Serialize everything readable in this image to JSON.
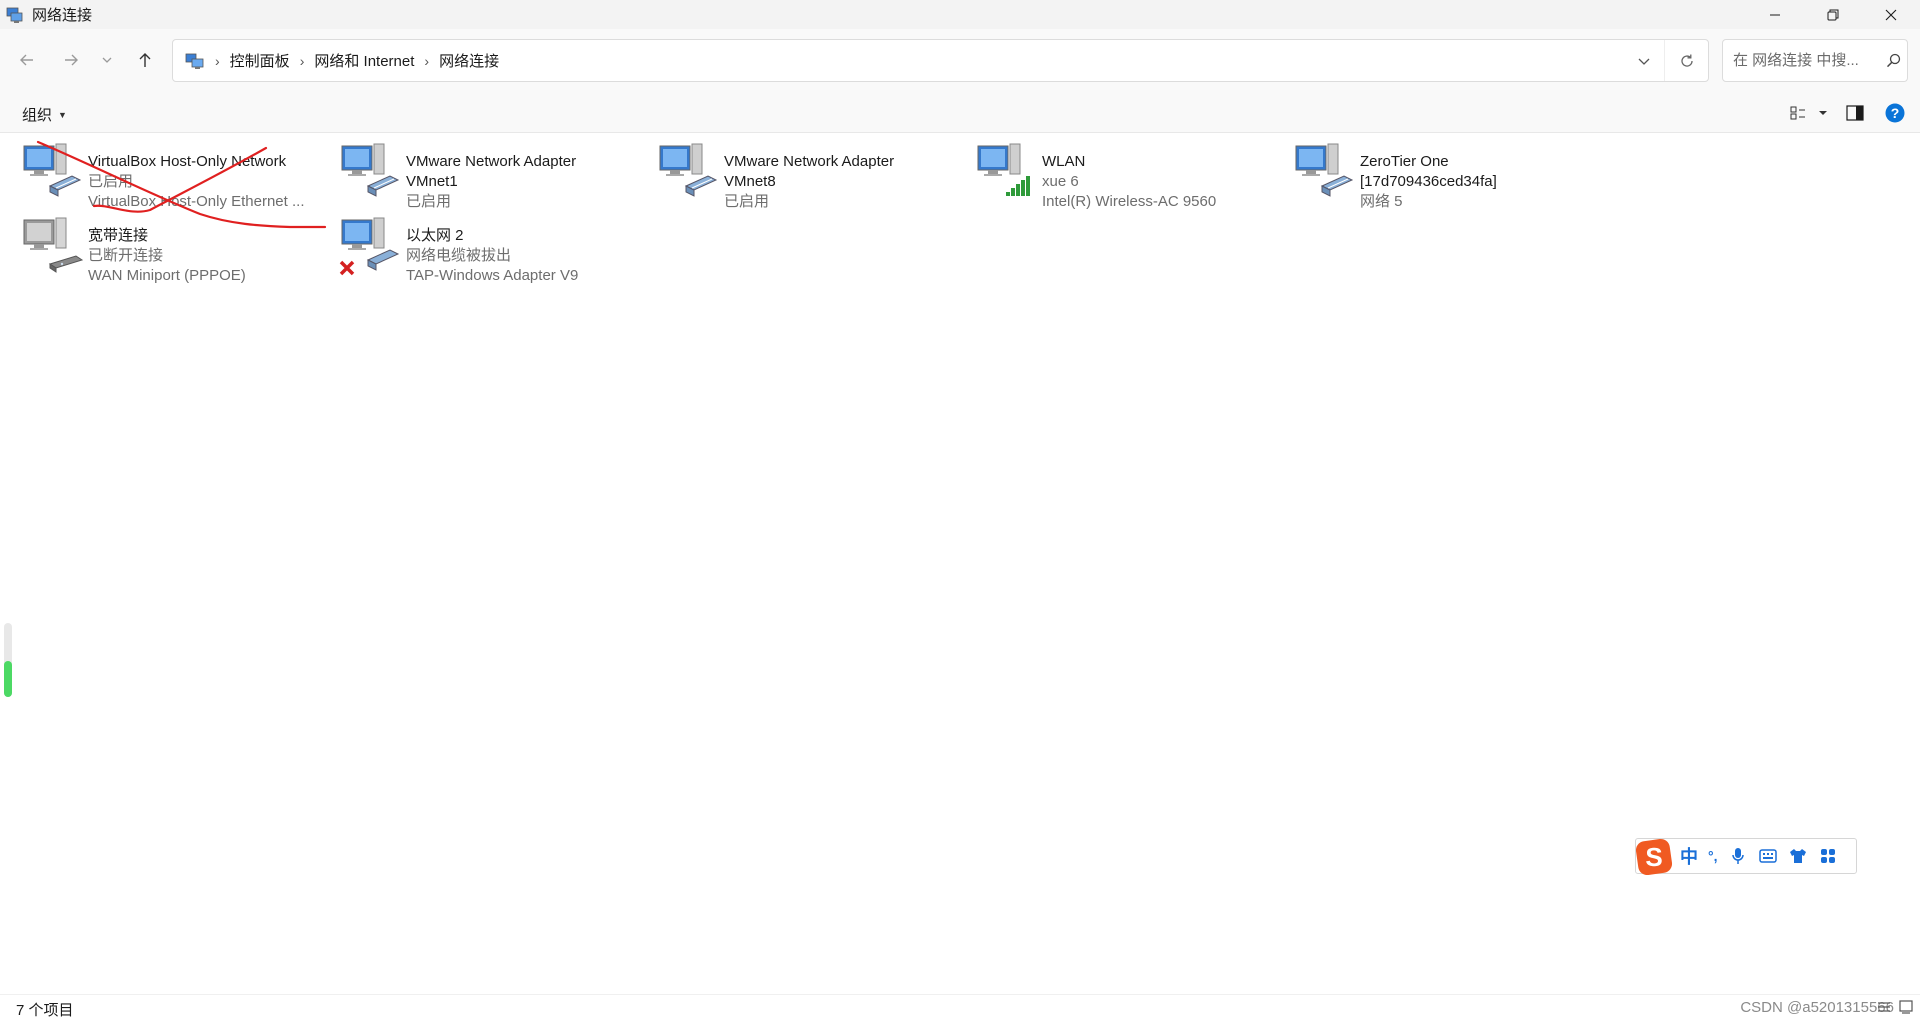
{
  "window": {
    "title": "网络连接"
  },
  "breadcrumb": [
    "控制面板",
    "网络和 Internet",
    "网络连接"
  ],
  "search": {
    "placeholder": "在 网络连接 中搜..."
  },
  "toolbar": {
    "organize_label": "组织"
  },
  "connections": [
    {
      "name": "VirtualBox Host-Only Network",
      "line2": "已启用",
      "line3": "VirtualBox Host-Only Ethernet ...",
      "type": "wired",
      "status": "enabled",
      "crossed_out": true
    },
    {
      "name": "VMware Network Adapter",
      "line2": "VMnet1",
      "line3": "已启用",
      "type": "wired",
      "status": "enabled"
    },
    {
      "name": "VMware Network Adapter",
      "line2": "VMnet8",
      "line3": "已启用",
      "type": "wired",
      "status": "enabled"
    },
    {
      "name": "WLAN",
      "line2": "xue 6",
      "line3": "Intel(R) Wireless-AC 9560",
      "type": "wireless",
      "status": "connected"
    },
    {
      "name": "ZeroTier One",
      "line2": "[17d709436ced34fa]",
      "line3": "网络 5",
      "type": "wired",
      "status": "enabled"
    },
    {
      "name": "宽带连接",
      "line2": "已断开连接",
      "line3": "WAN Miniport (PPPOE)",
      "type": "broadband",
      "status": "disconnected"
    },
    {
      "name": "以太网 2",
      "line2": "网络电缆被拔出",
      "line3": "TAP-Windows Adapter V9",
      "type": "wired",
      "status": "unplugged"
    }
  ],
  "status_bar": {
    "item_count": "7 个项目"
  },
  "watermark": "CSDN @a5201315566",
  "ime": {
    "mode": "中",
    "punct": "°,"
  },
  "colors": {
    "accent": "#0067c0",
    "annotation_red": "#e02020",
    "ime_blue": "#1a6fd8",
    "ime_logo": "#f05a22"
  }
}
